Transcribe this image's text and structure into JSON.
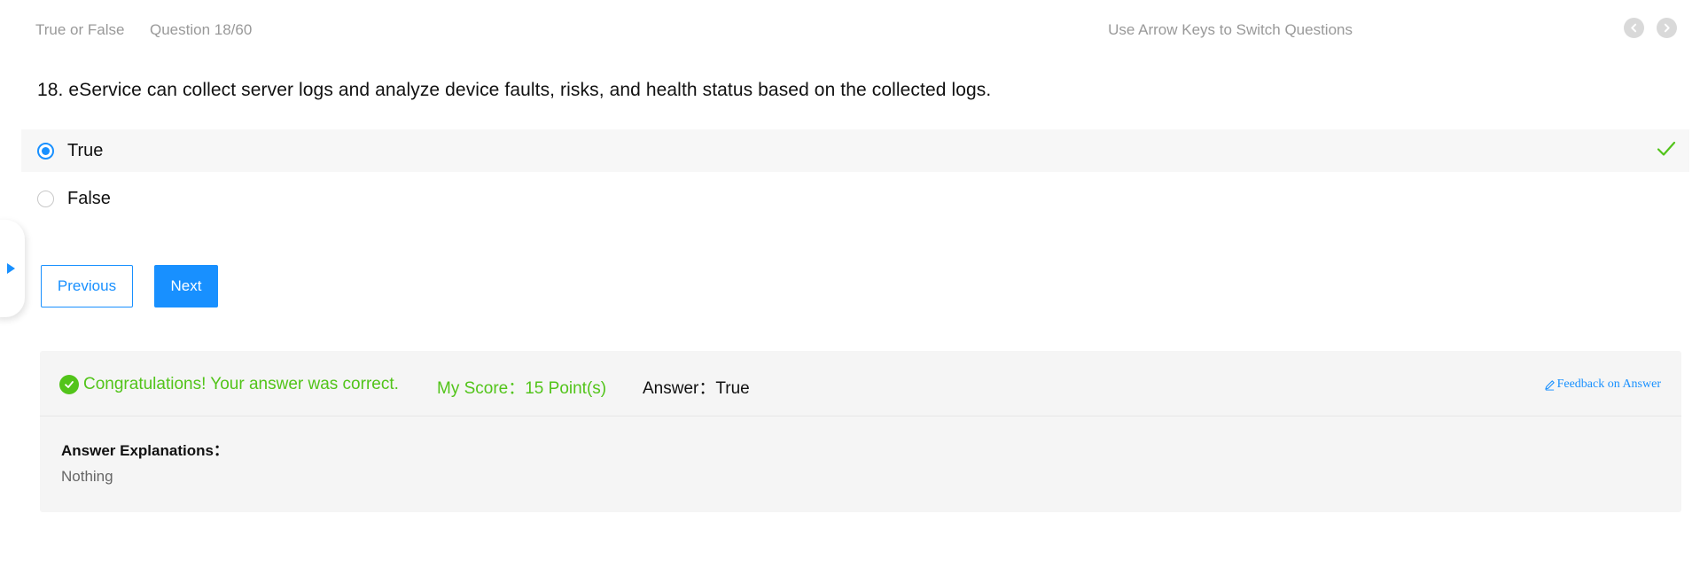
{
  "header": {
    "question_type": "True or False",
    "question_counter": "Question 18/60",
    "hint": "Use Arrow Keys to Switch Questions",
    "prev_icon": "chevron-left-icon",
    "next_icon": "chevron-right-icon"
  },
  "question": {
    "text": "18. eService can collect server logs and analyze device faults, risks, and health status based on the collected logs."
  },
  "options": [
    {
      "label": "True",
      "selected": true,
      "correct": true
    },
    {
      "label": "False",
      "selected": false,
      "correct": false
    }
  ],
  "buttons": {
    "previous": "Previous",
    "next": "Next"
  },
  "result": {
    "message": "Congratulations! Your answer was correct.",
    "score": "My Score：15 Point(s)",
    "answer": "Answer：True",
    "feedback_link": "Feedback on Answer",
    "explanation_title": "Answer Explanations：",
    "explanation_body": "Nothing"
  },
  "colors": {
    "accent": "#1890ff",
    "success": "#52c41a",
    "muted_text": "#999999",
    "panel_bg": "#f5f5f5"
  }
}
